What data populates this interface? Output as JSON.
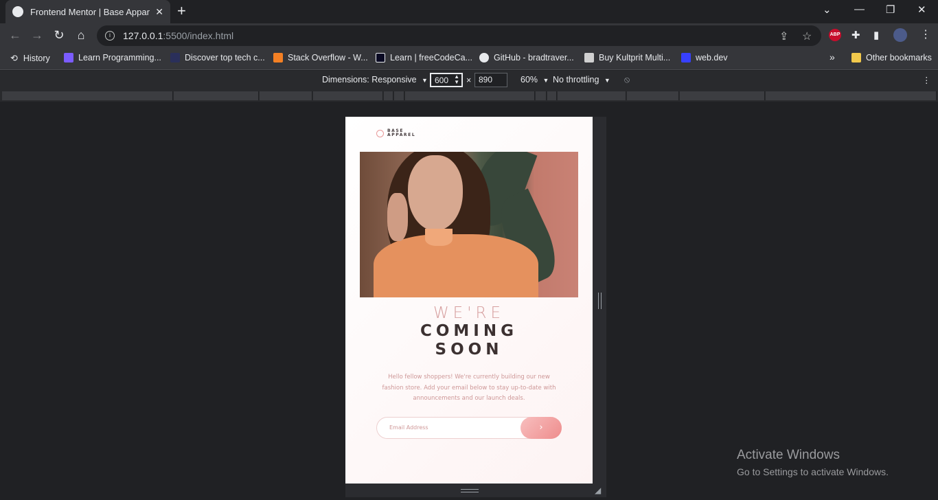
{
  "browser": {
    "tab_title": "Frontend Mentor | Base Apparel c",
    "address_host": "127.0.0.1",
    "address_path": ":5500/index.html"
  },
  "bookmarks": [
    {
      "label": "History",
      "color": "#e8eaed"
    },
    {
      "label": "Learn Programming...",
      "color": "#7b5cff"
    },
    {
      "label": "Discover top tech c...",
      "color": "#2a2f5a"
    },
    {
      "label": "Stack Overflow - W...",
      "color": "#f48024"
    },
    {
      "label": "Learn | freeCodeCa...",
      "color": "#0a0a23"
    },
    {
      "label": "GitHub - bradtraver...",
      "color": "#e8eaed"
    },
    {
      "label": "Buy Kultprit Multi...",
      "color": "#d0d0d0"
    },
    {
      "label": "web.dev",
      "color": "#3740ff"
    }
  ],
  "other_bookmarks": "Other bookmarks",
  "devtools": {
    "dimensions_label": "Dimensions: Responsive",
    "width": "600",
    "times": "×",
    "height": "890",
    "zoom": "60%",
    "throttling": "No throttling"
  },
  "site": {
    "logo_line1": "BASE",
    "logo_line2": "APPAREL",
    "headline_light": "WE'RE",
    "headline_dark1": "COMING",
    "headline_dark2": "SOON",
    "body": "Hello fellow shoppers! We're currently building our new fashion store. Add your email below to stay up-to-date with announcements and our launch deals.",
    "email_placeholder": "Email Address",
    "submit_icon": "›"
  },
  "watermark": {
    "title": "Activate Windows",
    "subtitle": "Go to Settings to activate Windows."
  },
  "icons": {
    "back": "←",
    "forward": "→",
    "reload": "↻",
    "home": "⌂",
    "share": "⇪",
    "star": "☆",
    "extensions": "✚",
    "sidepanel": "▮",
    "menu": "⋮",
    "chevron": "⌄",
    "minimize": "—",
    "restore": "❐",
    "close": "✕",
    "new_tab": "+",
    "tab_close": "✕",
    "abp": "ABP",
    "bookmarks_overflow": "»",
    "dropdown": "▼",
    "rotate": "⦸"
  }
}
